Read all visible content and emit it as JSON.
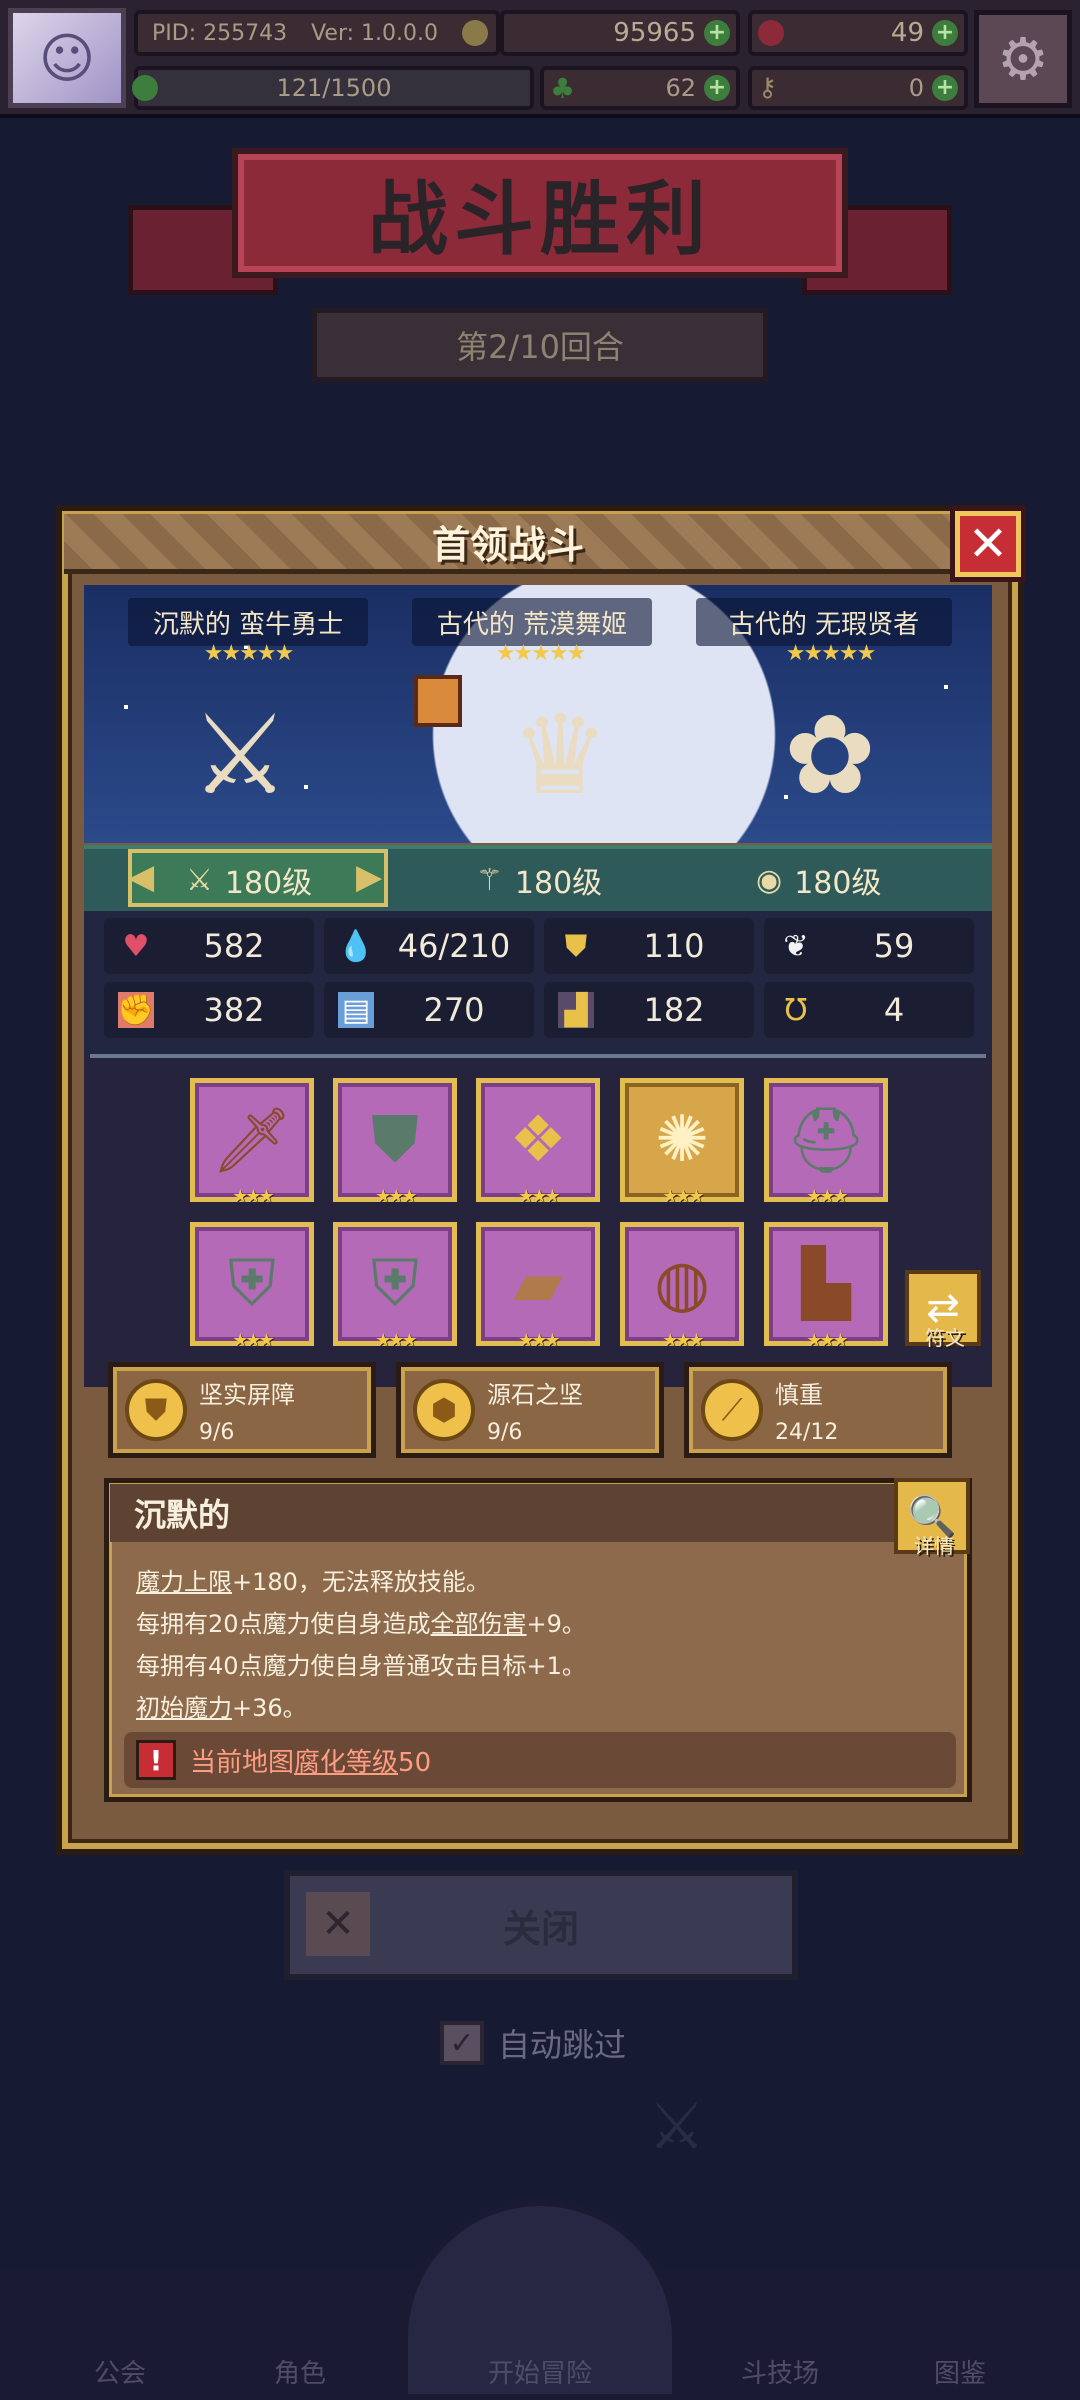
{
  "topbar": {
    "pid": "PID: 255743",
    "version": "Ver: 1.0.0.0",
    "gold": "95965",
    "gems": "49",
    "exp": "121/1500",
    "clover": "62",
    "keys": "0"
  },
  "banner": {
    "title": "战斗胜利",
    "round": "第2/10回合"
  },
  "modal": {
    "title": "首领战斗",
    "heroes": [
      {
        "name": "沉默的 蛮牛勇士",
        "stars": "★★★★★",
        "level": "180级"
      },
      {
        "name": "古代的 荒漠舞姬",
        "stars": "★★★★★",
        "level": "180级"
      },
      {
        "name": "古代的 无瑕贤者",
        "stars": "★★★★★",
        "level": "180级"
      }
    ],
    "stats": [
      {
        "icon": "heart-icon",
        "value": "582"
      },
      {
        "icon": "mana-drop-icon",
        "value": "46/210"
      },
      {
        "icon": "shield-icon",
        "value": "110"
      },
      {
        "icon": "wing-icon",
        "value": "59"
      },
      {
        "icon": "fist-icon",
        "value": "382"
      },
      {
        "icon": "book-icon",
        "value": "270"
      },
      {
        "icon": "boot-icon",
        "value": "182"
      },
      {
        "icon": "horseshoe-icon",
        "value": "4"
      }
    ],
    "equipment_stars": "★★★",
    "rune_label": "符文",
    "sets": [
      {
        "name": "坚实屏障",
        "count": "9/6"
      },
      {
        "name": "源石之坚",
        "count": "9/6"
      },
      {
        "name": "慎重",
        "count": "24/12"
      }
    ],
    "trait": {
      "title": "沉默的",
      "detail_label": "详情",
      "line1_u": "魔力上限",
      "line1_rest": "+180，无法释放技能。",
      "line2_pre": "每拥有20点魔力使自身造成",
      "line2_u": "全部伤害",
      "line2_post": "+9。",
      "line3": "每拥有40点魔力使自身普通攻击目标+1。",
      "line4_u": "初始魔力",
      "line4_rest": "+36。",
      "warn_pre": "当前地图",
      "warn_u": "腐化等级",
      "warn_post": "50"
    }
  },
  "close_button": "关闭",
  "auto_skip": "自动跳过",
  "nav": {
    "guild": "公会",
    "roles": "角色",
    "start": "开始冒险",
    "arena": "斗技场",
    "codex": "图鉴"
  }
}
